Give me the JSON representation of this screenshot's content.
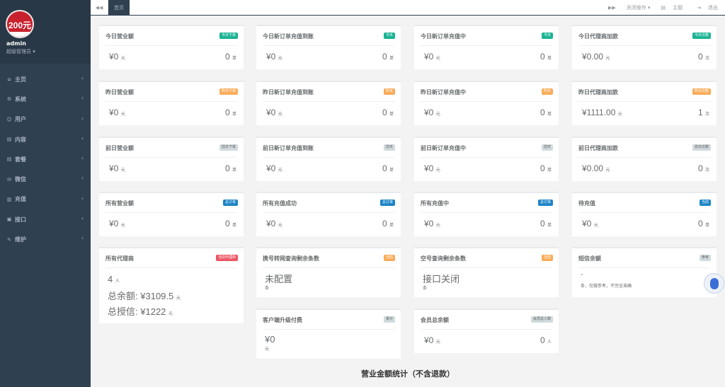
{
  "sidebar": {
    "profile": {
      "avatar_text": "200元",
      "name": "admin",
      "role": "超级管理员 ▾"
    },
    "menu": [
      {
        "label": "主页",
        "icon": "home-icon",
        "glyph": "⌂"
      },
      {
        "label": "系统",
        "icon": "cogs-icon",
        "glyph": "⚙"
      },
      {
        "label": "用户",
        "icon": "users-icon",
        "glyph": "☺"
      },
      {
        "label": "内容",
        "icon": "file-icon",
        "glyph": "▤"
      },
      {
        "label": "套餐",
        "icon": "file-text-icon",
        "glyph": "▤"
      },
      {
        "label": "微信",
        "icon": "wechat-icon",
        "glyph": "✉"
      },
      {
        "label": "充值",
        "icon": "recharge-icon",
        "glyph": "▥"
      },
      {
        "label": "接口",
        "icon": "interface-icon",
        "glyph": "▣"
      },
      {
        "label": "维护",
        "icon": "wrench-icon",
        "glyph": "✎"
      }
    ],
    "arrow": "‹"
  },
  "topbar": {
    "back_glyph": "◀◀",
    "active_tab": "首页",
    "forward_glyph": "▶▶",
    "close_ops": "关闭操作 ▾",
    "theme": "主题",
    "theme_glyph": "▤",
    "logout": "退出",
    "logout_glyph": "⇥"
  },
  "cards": [
    {
      "title": "今日营业额",
      "badge": "今日下单",
      "value": "¥0",
      "vunit": "元",
      "count": "0",
      "cunit": "单"
    },
    {
      "title": "今日新订单充值到账",
      "badge": "今天",
      "value": "¥0",
      "vunit": "元",
      "count": "0",
      "cunit": "单"
    },
    {
      "title": "今日新订单充值中",
      "badge": "今天",
      "value": "¥0",
      "vunit": "元",
      "count": "0",
      "cunit": "单"
    },
    {
      "title": "今日代理商加款",
      "badge": "今日次数",
      "value": "¥0.00",
      "vunit": "元",
      "count": "0",
      "cunit": "次"
    },
    {
      "title": "昨日营业额",
      "badge": "昨日下单",
      "value": "¥0",
      "vunit": "元",
      "count": "0",
      "cunit": "单"
    },
    {
      "title": "昨日新订单充值到账",
      "badge": "昨天",
      "value": "¥0",
      "vunit": "元",
      "count": "0",
      "cunit": "单"
    },
    {
      "title": "昨日新订单充值中",
      "badge": "昨天",
      "value": "¥0",
      "vunit": "元",
      "count": "0",
      "cunit": "单"
    },
    {
      "title": "昨日代理商加款",
      "badge": "昨日次数",
      "value": "¥1111.00",
      "vunit": "元",
      "count": "1",
      "cunit": "次"
    },
    {
      "title": "前日营业额",
      "badge": "前日下单",
      "value": "¥0",
      "vunit": "元",
      "count": "0",
      "cunit": "单"
    },
    {
      "title": "前日新订单充值到账",
      "badge": "前天",
      "value": "¥0",
      "vunit": "元",
      "count": "0",
      "cunit": "单"
    },
    {
      "title": "前日新订单充值中",
      "badge": "前天",
      "value": "¥0",
      "vunit": "元",
      "count": "0",
      "cunit": "单"
    },
    {
      "title": "前日代理商加款",
      "badge": "前日次数",
      "value": "¥0.00",
      "vunit": "元",
      "count": "0",
      "cunit": "次"
    },
    {
      "title": "所有营业额",
      "badge": "总订单",
      "value": "¥0",
      "vunit": "元",
      "count": "0",
      "cunit": "单"
    },
    {
      "title": "所有充值成功",
      "badge": "总订单",
      "value": "¥0",
      "vunit": "元",
      "count": "0",
      "cunit": "单"
    },
    {
      "title": "所有充值中",
      "badge": "总订单",
      "value": "¥0",
      "vunit": "元",
      "count": "0",
      "cunit": "单"
    },
    {
      "title": "待充值",
      "badge": "当前",
      "value": "¥0",
      "vunit": "元",
      "count": "0",
      "cunit": "单"
    }
  ],
  "agents": {
    "title": "所有代理商",
    "badge": "当前代理商",
    "count": "4",
    "count_unit": "人",
    "balance_label": "总余额:",
    "balance": "¥3109.5",
    "balance_unit": "元",
    "credit_label": "总授信:",
    "credit": "¥1222",
    "credit_unit": "元"
  },
  "portability": {
    "title": "携号转网查询剩余条数",
    "badge": "当前",
    "value": "未配置",
    "unit": "条"
  },
  "emptyno": {
    "title": "空号查询剩余条数",
    "badge": "当前",
    "value": "接口关闭",
    "unit": "条"
  },
  "sms": {
    "title": "短信余额",
    "badge": "参考",
    "value": "-",
    "note": "条，仅做参考，不完全准确"
  },
  "upgrade": {
    "title": "客户端升级付费",
    "badge": "累计",
    "value": "¥0",
    "unit": "元"
  },
  "members": {
    "title": "会员总余额",
    "badge": "会员总人数",
    "value": "¥0",
    "vunit": "元",
    "count": "0",
    "cunit": "人"
  },
  "section_title": "营业金额统计（不含退款）"
}
